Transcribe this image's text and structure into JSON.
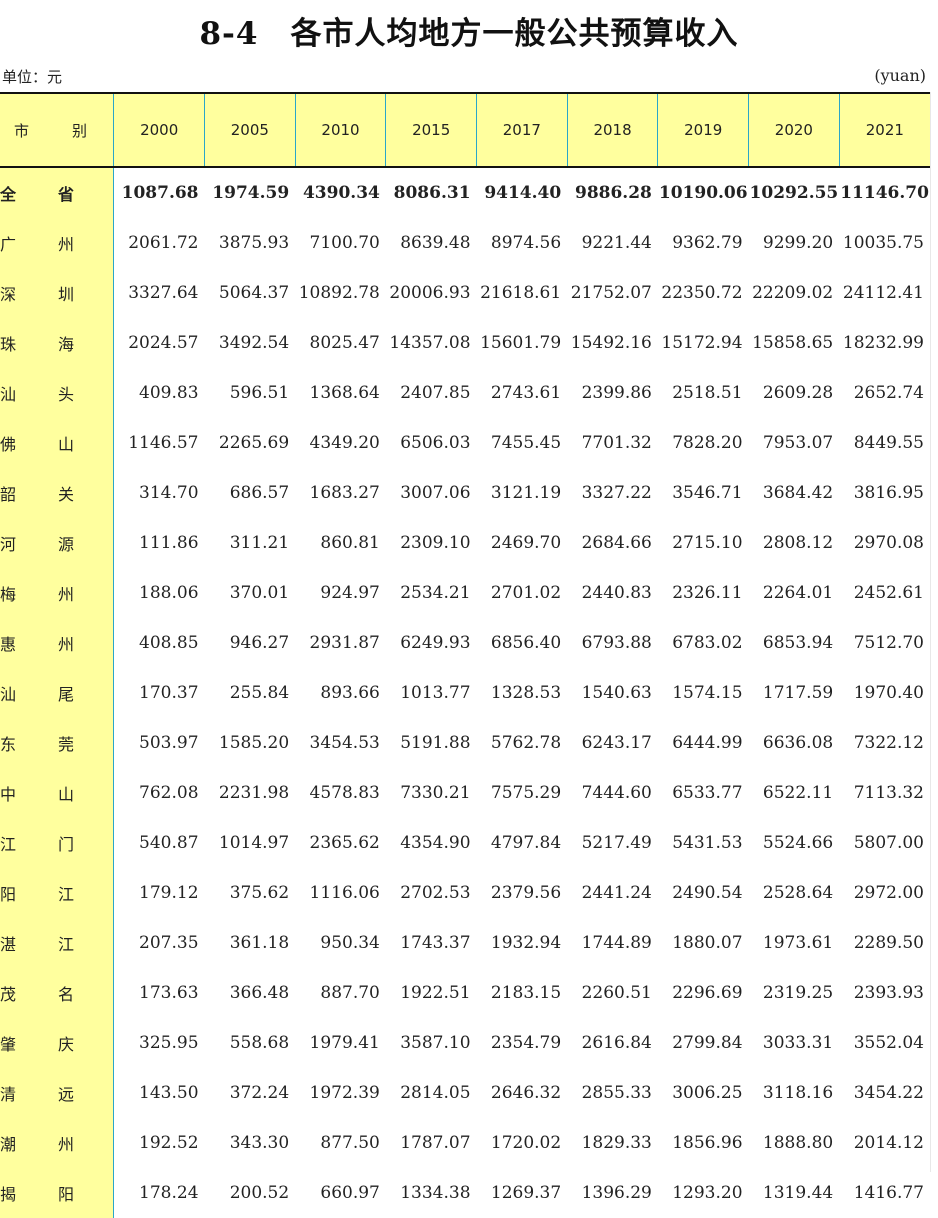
{
  "title": "8-4　各市人均地方一般公共预算收入",
  "unit_left": "单位：元",
  "unit_right": "(yuan)",
  "header": {
    "city_a": "市",
    "city_b": "别",
    "years": [
      "2000",
      "2005",
      "2010",
      "2015",
      "2017",
      "2018",
      "2019",
      "2020",
      "2021"
    ]
  },
  "rows": [
    {
      "c1": "全",
      "c2": "省",
      "v": [
        "1087.68",
        "1974.59",
        "4390.34",
        "8086.31",
        "9414.40",
        "9886.28",
        "10190.06",
        "10292.55",
        "11146.70"
      ]
    },
    {
      "c1": "广",
      "c2": "州",
      "v": [
        "2061.72",
        "3875.93",
        "7100.70",
        "8639.48",
        "8974.56",
        "9221.44",
        "9362.79",
        "9299.20",
        "10035.75"
      ]
    },
    {
      "c1": "深",
      "c2": "圳",
      "v": [
        "3327.64",
        "5064.37",
        "10892.78",
        "20006.93",
        "21618.61",
        "21752.07",
        "22350.72",
        "22209.02",
        "24112.41"
      ]
    },
    {
      "c1": "珠",
      "c2": "海",
      "v": [
        "2024.57",
        "3492.54",
        "8025.47",
        "14357.08",
        "15601.79",
        "15492.16",
        "15172.94",
        "15858.65",
        "18232.99"
      ]
    },
    {
      "c1": "汕",
      "c2": "头",
      "v": [
        "409.83",
        "596.51",
        "1368.64",
        "2407.85",
        "2743.61",
        "2399.86",
        "2518.51",
        "2609.28",
        "2652.74"
      ]
    },
    {
      "c1": "佛",
      "c2": "山",
      "v": [
        "1146.57",
        "2265.69",
        "4349.20",
        "6506.03",
        "7455.45",
        "7701.32",
        "7828.20",
        "7953.07",
        "8449.55"
      ]
    },
    {
      "c1": "韶",
      "c2": "关",
      "v": [
        "314.70",
        "686.57",
        "1683.27",
        "3007.06",
        "3121.19",
        "3327.22",
        "3546.71",
        "3684.42",
        "3816.95"
      ]
    },
    {
      "c1": "河",
      "c2": "源",
      "v": [
        "111.86",
        "311.21",
        "860.81",
        "2309.10",
        "2469.70",
        "2684.66",
        "2715.10",
        "2808.12",
        "2970.08"
      ]
    },
    {
      "c1": "梅",
      "c2": "州",
      "v": [
        "188.06",
        "370.01",
        "924.97",
        "2534.21",
        "2701.02",
        "2440.83",
        "2326.11",
        "2264.01",
        "2452.61"
      ]
    },
    {
      "c1": "惠",
      "c2": "州",
      "v": [
        "408.85",
        "946.27",
        "2931.87",
        "6249.93",
        "6856.40",
        "6793.88",
        "6783.02",
        "6853.94",
        "7512.70"
      ]
    },
    {
      "c1": "汕",
      "c2": "尾",
      "v": [
        "170.37",
        "255.84",
        "893.66",
        "1013.77",
        "1328.53",
        "1540.63",
        "1574.15",
        "1717.59",
        "1970.40"
      ]
    },
    {
      "c1": "东",
      "c2": "莞",
      "v": [
        "503.97",
        "1585.20",
        "3454.53",
        "5191.88",
        "5762.78",
        "6243.17",
        "6444.99",
        "6636.08",
        "7322.12"
      ]
    },
    {
      "c1": "中",
      "c2": "山",
      "v": [
        "762.08",
        "2231.98",
        "4578.83",
        "7330.21",
        "7575.29",
        "7444.60",
        "6533.77",
        "6522.11",
        "7113.32"
      ]
    },
    {
      "c1": "江",
      "c2": "门",
      "v": [
        "540.87",
        "1014.97",
        "2365.62",
        "4354.90",
        "4797.84",
        "5217.49",
        "5431.53",
        "5524.66",
        "5807.00"
      ]
    },
    {
      "c1": "阳",
      "c2": "江",
      "v": [
        "179.12",
        "375.62",
        "1116.06",
        "2702.53",
        "2379.56",
        "2441.24",
        "2490.54",
        "2528.64",
        "2972.00"
      ]
    },
    {
      "c1": "湛",
      "c2": "江",
      "v": [
        "207.35",
        "361.18",
        "950.34",
        "1743.37",
        "1932.94",
        "1744.89",
        "1880.07",
        "1973.61",
        "2289.50"
      ]
    },
    {
      "c1": "茂",
      "c2": "名",
      "v": [
        "173.63",
        "366.48",
        "887.70",
        "1922.51",
        "2183.15",
        "2260.51",
        "2296.69",
        "2319.25",
        "2393.93"
      ]
    },
    {
      "c1": "肇",
      "c2": "庆",
      "v": [
        "325.95",
        "558.68",
        "1979.41",
        "3587.10",
        "2354.79",
        "2616.84",
        "2799.84",
        "3033.31",
        "3552.04"
      ]
    },
    {
      "c1": "清",
      "c2": "远",
      "v": [
        "143.50",
        "372.24",
        "1972.39",
        "2814.05",
        "2646.32",
        "2855.33",
        "3006.25",
        "3118.16",
        "3454.22"
      ]
    },
    {
      "c1": "潮",
      "c2": "州",
      "v": [
        "192.52",
        "343.30",
        "877.50",
        "1787.07",
        "1720.02",
        "1829.33",
        "1856.96",
        "1888.80",
        "2014.12"
      ]
    },
    {
      "c1": "揭",
      "c2": "阳",
      "v": [
        "178.24",
        "200.52",
        "660.97",
        "1334.38",
        "1269.37",
        "1396.29",
        "1293.20",
        "1319.44",
        "1416.77"
      ]
    }
  ]
}
